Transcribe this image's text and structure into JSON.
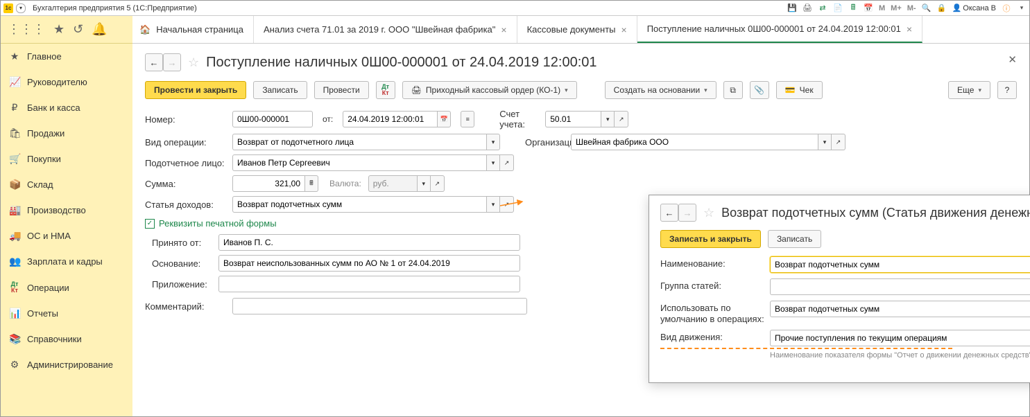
{
  "titlebar": {
    "app_title": "Бухгалтерия предприятия 5   (1С:Предприятие)",
    "user": "Оксана В",
    "m": "М",
    "mplus": "М+",
    "mminus": "М-"
  },
  "sidebar": {
    "items": [
      {
        "icon": "★",
        "label": "Главное"
      },
      {
        "icon": "📈",
        "label": "Руководителю"
      },
      {
        "icon": "₽",
        "label": "Банк и касса"
      },
      {
        "icon": "🛍",
        "label": "Продажи"
      },
      {
        "icon": "🛒",
        "label": "Покупки"
      },
      {
        "icon": "📦",
        "label": "Склад"
      },
      {
        "icon": "🏭",
        "label": "Производство"
      },
      {
        "icon": "🚚",
        "label": "ОС и НМА"
      },
      {
        "icon": "👥",
        "label": "Зарплата и кадры"
      },
      {
        "icon": "Дт/Кт",
        "label": "Операции"
      },
      {
        "icon": "📊",
        "label": "Отчеты"
      },
      {
        "icon": "📚",
        "label": "Справочники"
      },
      {
        "icon": "⚙",
        "label": "Администрирование"
      }
    ]
  },
  "tabs": [
    {
      "label": "Начальная страница",
      "home": true
    },
    {
      "label": "Анализ счета 71.01 за 2019 г. ООО \"Швейная фабрика\"",
      "closable": true
    },
    {
      "label": "Кассовые документы",
      "closable": true
    },
    {
      "label": "Поступление наличных 0Ш00-000001 от 24.04.2019 12:00:01",
      "closable": true,
      "active": true
    }
  ],
  "doc": {
    "title": "Поступление наличных 0Ш00-000001 от 24.04.2019 12:00:01",
    "toolbar": {
      "post_close": "Провести и закрыть",
      "save": "Записать",
      "post": "Провести",
      "print": "Приходный кассовый ордер (КО-1)",
      "create_based": "Создать на основании",
      "check": "Чек",
      "more": "Еще"
    },
    "fields": {
      "number_label": "Номер:",
      "number": "0Ш00-000001",
      "from_label": "от:",
      "date": "24.04.2019 12:00:01",
      "account_label": "Счет учета:",
      "account": "50.01",
      "optype_label": "Вид операции:",
      "optype": "Возврат от подотчетного лица",
      "org_label": "Организация:",
      "org": "Швейная фабрика ООО",
      "person_label": "Подотчетное лицо:",
      "person": "Иванов Петр Сергеевич",
      "sum_label": "Сумма:",
      "sum": "321,00",
      "currency_label": "Валюта:",
      "currency": "руб.",
      "income_label": "Статья доходов:",
      "income": "Возврат подотчетных сумм",
      "section": "Реквизиты печатной формы",
      "received_label": "Принято от:",
      "received": "Иванов П. С.",
      "basis_label": "Основание:",
      "basis": "Возврат неиспользованных сумм по АО № 1 от 24.04.2019",
      "attach_label": "Приложение:",
      "attach": "",
      "comment_label": "Комментарий:",
      "comment": ""
    }
  },
  "popup": {
    "title": "Возврат подотчетных сумм (Статья движения денежных средств)",
    "save_close": "Записать и закрыть",
    "save": "Записать",
    "name_label": "Наименование:",
    "name": "Возврат подотчетных сумм",
    "group_label": "Группа статей:",
    "group": "",
    "default_label": "Использовать по умолчанию в операциях:",
    "default": "Возврат подотчетных сумм",
    "movetype_label": "Вид движения:",
    "movetype": "Прочие поступления по текущим операциям",
    "hint": "Наименование показателя формы \"Отчет о движении денежных средств\" бухгалтерской отчетности"
  }
}
